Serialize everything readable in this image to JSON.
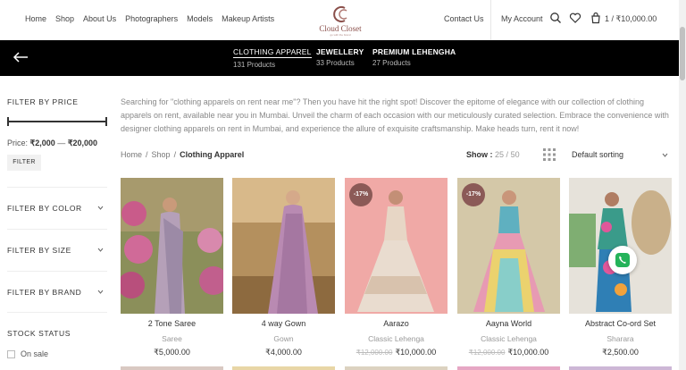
{
  "header": {
    "nav_left": [
      "Home",
      "Shop",
      "About Us",
      "Photographers",
      "Models",
      "Makeup Artists"
    ],
    "logo_text": "Cloud Closet",
    "logo_sub": "go with the brand",
    "contact": "Contact Us",
    "account": "My Account",
    "cart": "1 / ₹10,000.00",
    "icons": [
      "search-icon",
      "heart-icon",
      "cart-icon"
    ]
  },
  "categories": [
    {
      "title": "CLOTHING APPAREL",
      "count": "131 Products",
      "active": true
    },
    {
      "title": "JEWELLERY",
      "count": "33 Products",
      "active": false
    },
    {
      "title": "PREMIUM LEHENGHA",
      "count": "27 Products",
      "active": false
    }
  ],
  "sidebar": {
    "price_title": "FILTER BY PRICE",
    "price_label": "Price:",
    "price_min": "₹2,000",
    "price_sep": "—",
    "price_max": "₹20,000",
    "filter_button": "FILTER",
    "filters": [
      "FILTER BY COLOR",
      "FILTER BY SIZE",
      "FILTER BY BRAND"
    ],
    "stock_title": "STOCK STATUS",
    "stock_option": "On sale"
  },
  "main": {
    "intro": "Searching for \"clothing apparels on rent near me\"? Then you have hit the right spot! Discover the epitome of elegance with our collection of clothing apparels on rent, available near you in Mumbai. Unveil the charm of each occasion with our meticulously curated selection. Embrace the convenience with designer clothing apparels on rent in Mumbai, and experience the allure of exquisite craftsmanship. Make heads turn, rent it now!",
    "breadcrumb": [
      "Home",
      "Shop",
      "Clothing Apparel"
    ],
    "breadcrumb_sep": "/",
    "show_label": "Show :",
    "show_options": [
      "25",
      "50"
    ],
    "show_sep": "/",
    "sort": "Default sorting"
  },
  "products": [
    {
      "name": "2 Tone Saree",
      "category": "Saree",
      "price": "₹5,000.00",
      "old_price": "",
      "badge": ""
    },
    {
      "name": "4 way Gown",
      "category": "Gown",
      "price": "₹4,000.00",
      "old_price": "",
      "badge": ""
    },
    {
      "name": "Aarazo",
      "category": "Classic Lehenga",
      "price": "₹10,000.00",
      "old_price": "₹12,000.00",
      "badge": "-17%"
    },
    {
      "name": "Aayna World",
      "category": "Classic Lehenga",
      "price": "₹10,000.00",
      "old_price": "₹12,000.00",
      "badge": "-17%"
    },
    {
      "name": "Abstract Co-ord Set",
      "category": "Sharara",
      "price": "₹2,500.00",
      "old_price": "",
      "badge": ""
    }
  ],
  "colors": {
    "accent": "#8b5a57",
    "bar": "#000000",
    "whatsapp": "#25b35a"
  }
}
